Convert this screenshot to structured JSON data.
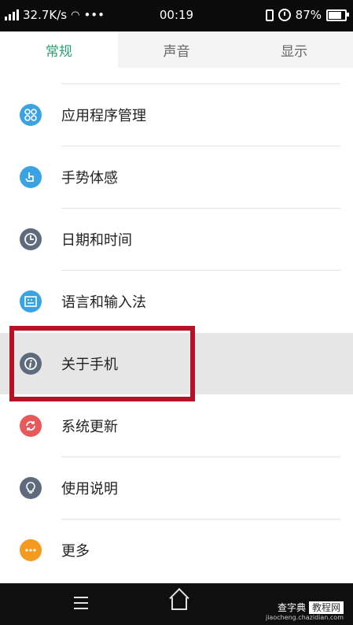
{
  "status_bar": {
    "network_speed": "32.7K/s",
    "overflow": "•••",
    "time": "00:19",
    "battery": "87%",
    "battery_level": 0.87
  },
  "tabs": [
    {
      "label": "常规",
      "active": true
    },
    {
      "label": "声音",
      "active": false
    },
    {
      "label": "显示",
      "active": false
    }
  ],
  "items": [
    {
      "label": "应用程序管理",
      "icon": "apps-icon",
      "color": "#3aa3e3"
    },
    {
      "label": "手势体感",
      "icon": "gesture-icon",
      "color": "#3aa3e3"
    },
    {
      "label": "日期和时间",
      "icon": "clock-icon",
      "color": "#5d6b7c"
    },
    {
      "label": "语言和输入法",
      "icon": "keyboard-icon",
      "color": "#3aa3e3"
    },
    {
      "label": "关于手机",
      "icon": "info-icon",
      "color": "#5d6b7c",
      "highlight": true
    },
    {
      "label": "系统更新",
      "icon": "update-icon",
      "color": "#e85a5a"
    },
    {
      "label": "使用说明",
      "icon": "lightbulb-icon",
      "color": "#5d6b7c"
    },
    {
      "label": "更多",
      "icon": "more-icon",
      "color": "#f39a1f"
    }
  ],
  "watermark": {
    "brand": "查字典",
    "box": "教程网",
    "url": "jiaocheng.chazidian.com"
  },
  "colors": {
    "accent": "#2e9d72",
    "highlight_border": "#b51226"
  }
}
